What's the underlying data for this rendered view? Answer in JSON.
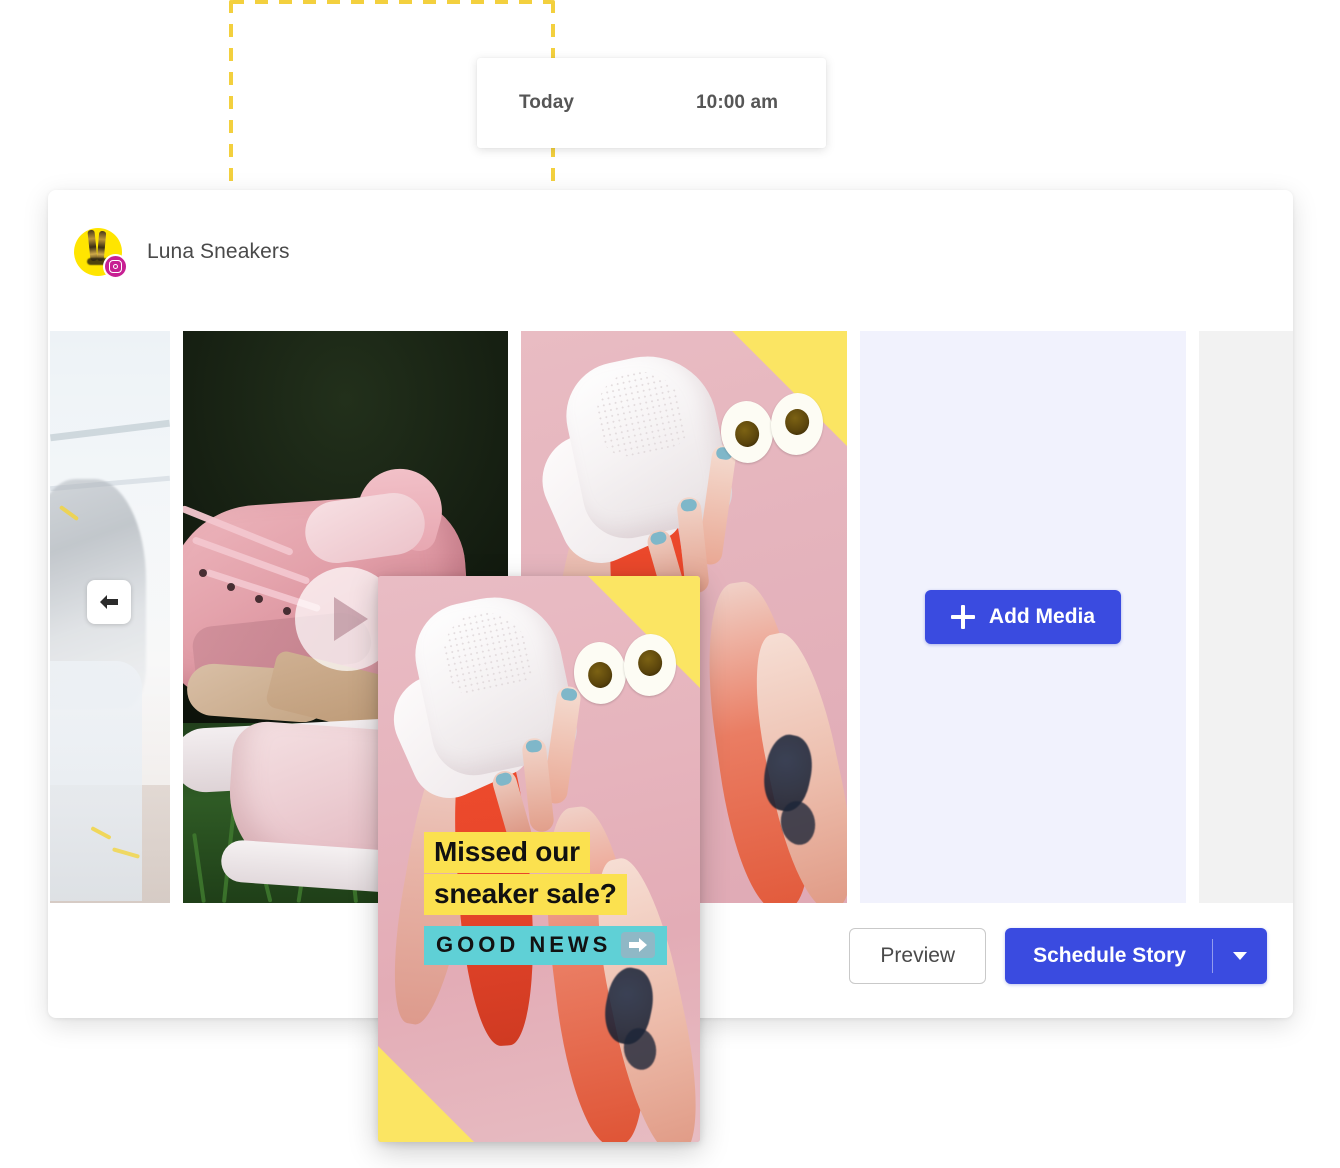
{
  "schedule_tooltip": {
    "day_label": "Today",
    "time_label": "10:00 am"
  },
  "composer": {
    "account": {
      "name": "Luna Sneakers",
      "avatar_icon": "sneakers-avatar",
      "network_badge_icon": "instagram-icon",
      "network": "Instagram"
    },
    "media_strip": {
      "prev_button_icon": "arrow-left-icon",
      "video_play_icon": "play-icon",
      "tiles": [
        {
          "name": "street-photo",
          "type": "image"
        },
        {
          "name": "pink-sneaker-grass-video",
          "type": "video"
        },
        {
          "name": "legs-and-eyes-photo",
          "type": "image"
        },
        {
          "name": "add-media-placeholder",
          "type": "placeholder"
        },
        {
          "name": "empty-placeholder",
          "type": "placeholder"
        }
      ]
    },
    "add_media": {
      "label": "Add Media",
      "icon": "plus-icon",
      "color": "#3a4be0"
    },
    "actions": {
      "preview_label": "Preview",
      "schedule_label": "Schedule Story",
      "dropdown_icon": "chevron-down-icon",
      "primary_color": "#3a4be0"
    }
  },
  "story_preview": {
    "caption_line_1": "Missed our",
    "caption_line_2": "sneaker sale?",
    "cta_text": "GOOD NEWS",
    "cta_icon": "right-arrow-emoji",
    "highlight_color": "#fbe14f",
    "cta_background_color": "#5fd0d6",
    "accent_corner_color": "#fbe563"
  },
  "guides": {
    "color": "#f3d03e"
  }
}
